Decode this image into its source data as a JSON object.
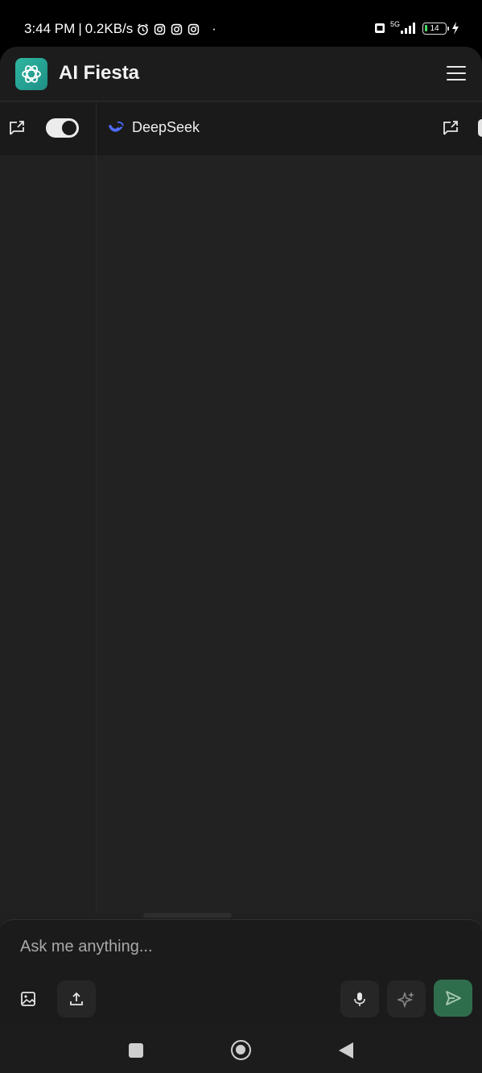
{
  "status_bar": {
    "time": "3:44 PM",
    "separator": "|",
    "network_speed": "0.2KB/s",
    "dot": "·",
    "network_type": "5G",
    "battery": "14",
    "icons": [
      "alarm-icon",
      "instagram-icon",
      "instagram-icon",
      "instagram-icon",
      "sim-icon",
      "signal-icon",
      "battery-icon",
      "charging-icon"
    ]
  },
  "header": {
    "title": "AI Fiesta",
    "logo_icon": "ai-fiesta-logo-icon",
    "menu_icon": "hamburger-menu-icon"
  },
  "panel_bar": {
    "model_name": "DeepSeek",
    "model_icon": "deepseek-whale-icon",
    "toggle_state": "on"
  },
  "composer": {
    "placeholder": "Ask me anything...",
    "buttons": [
      "image-icon",
      "upload-icon",
      "microphone-icon",
      "sparkle-icon",
      "send-icon"
    ]
  },
  "colors": {
    "accent": "#2f6e4c",
    "logo": "#2fb6a0",
    "deepseek": "#4d6bfe"
  }
}
